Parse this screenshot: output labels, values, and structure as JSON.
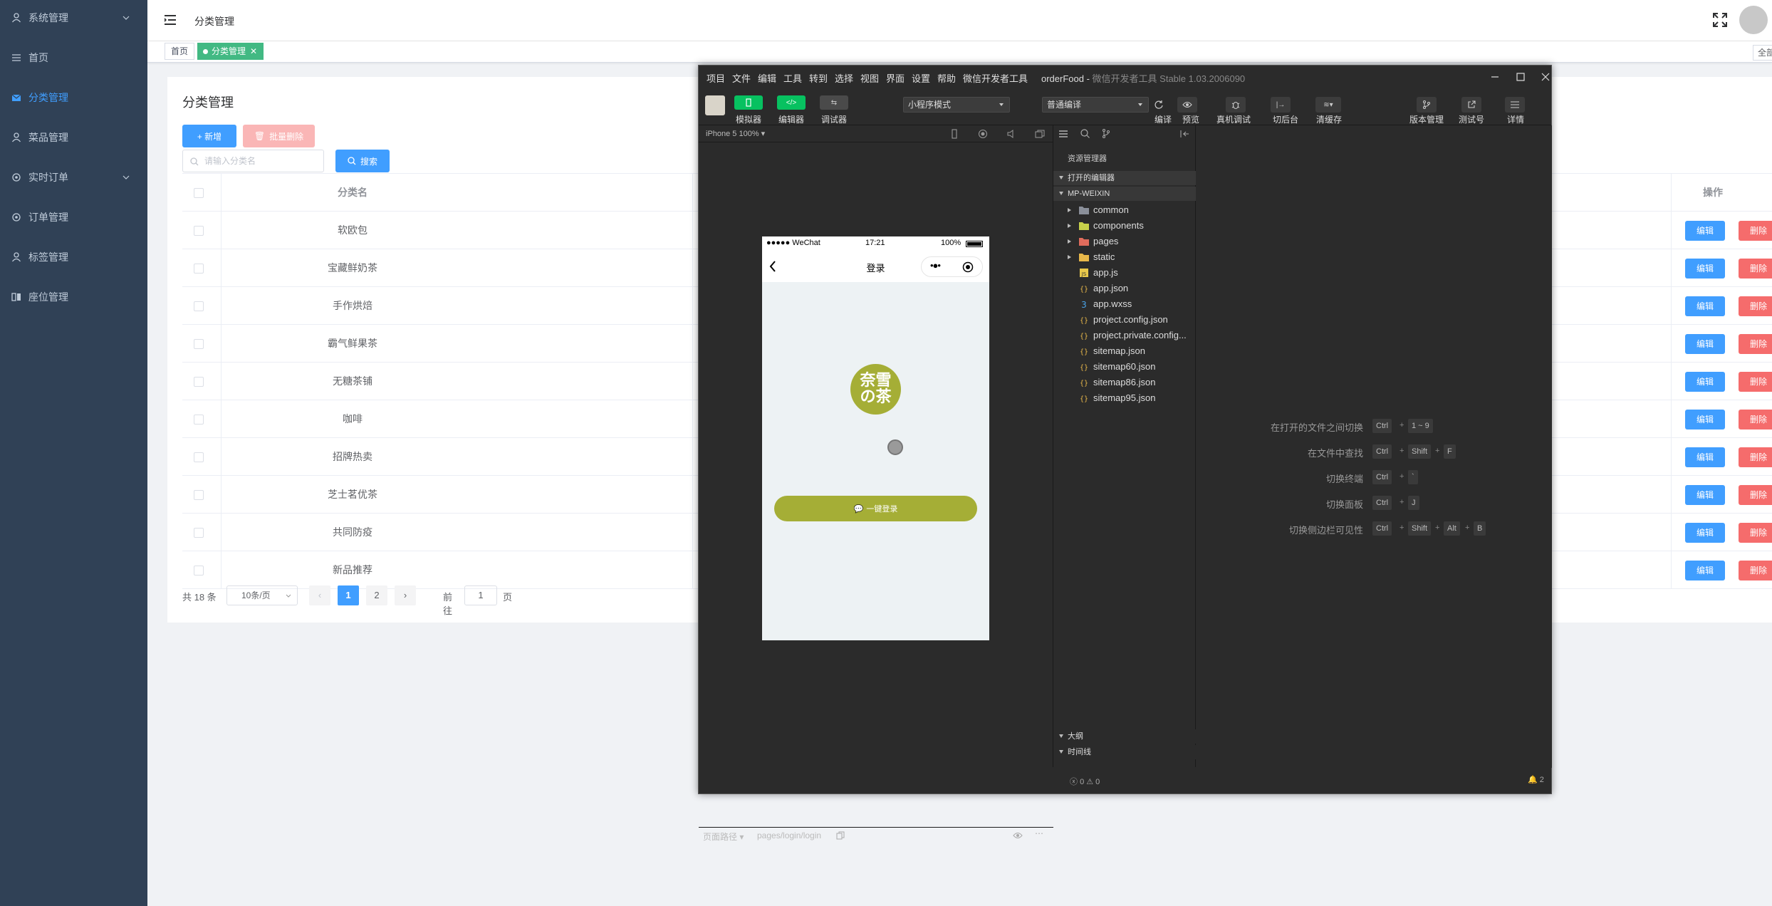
{
  "sidebar": {
    "items": [
      {
        "label": "系统管理",
        "icon": "user-icon",
        "expandable": true
      },
      {
        "label": "首页",
        "icon": "list-icon"
      },
      {
        "label": "分类管理",
        "icon": "mail-icon",
        "active": true
      },
      {
        "label": "菜品管理",
        "icon": "user-icon"
      },
      {
        "label": "实时订单",
        "icon": "gear-icon",
        "expandable": true
      },
      {
        "label": "订单管理",
        "icon": "gear-icon"
      },
      {
        "label": "标签管理",
        "icon": "user-icon"
      },
      {
        "label": "座位管理",
        "icon": "grid-icon"
      }
    ]
  },
  "header": {
    "breadcrumb": "分类管理"
  },
  "tags": {
    "home": "首页",
    "active": "分类管理",
    "close_all": "全部"
  },
  "page": {
    "title": "分类管理",
    "add_label": "+ 新增",
    "batch_delete_label": "批量删除",
    "search_placeholder": "请输入分类名",
    "search_label": "搜索",
    "column_name": "分类名",
    "column_action": "操作",
    "edit_label": "编辑",
    "delete_label": "删除",
    "rows": [
      "软欧包",
      "宝藏鲜奶茶",
      "手作烘焙",
      "霸气鲜果茶",
      "无糖茶铺",
      "咖啡",
      "招牌热卖",
      "芝士茗优茶",
      "共同防疫",
      "新品推荐"
    ]
  },
  "pager": {
    "total": "共 18 条",
    "page_size": "10条/页",
    "pages": [
      "1",
      "2"
    ],
    "current": "1",
    "goto_label": "前往",
    "goto_value": "1",
    "goto_unit": "页"
  },
  "devtools": {
    "menu": [
      "项目",
      "文件",
      "编辑",
      "工具",
      "转到",
      "选择",
      "视图",
      "界面",
      "设置",
      "帮助",
      "微信开发者工具"
    ],
    "project": "orderFood",
    "app_title": "微信开发者工具 Stable 1.03.2006090",
    "toolbar": {
      "simulator": "模拟器",
      "editor": "编辑器",
      "debugger": "调试器",
      "mode": "小程序模式",
      "compile_mode": "普通编译",
      "compile": "编译",
      "preview": "预览",
      "remote_debug": "真机调试",
      "background": "切后台",
      "clear_cache": "清缓存",
      "version": "版本管理",
      "test": "测试号",
      "detail": "详情"
    },
    "simulator": {
      "device": "iPhone 5 100%",
      "path_label": "页面路径",
      "path": "pages/login/login"
    },
    "phone": {
      "carrier": "●●●●● WeChat",
      "time": "17:21",
      "battery": "100%",
      "title": "登录",
      "logo_line1": "奈雪",
      "logo_line2": "の茶",
      "login_button": "一键登录"
    },
    "explorer": {
      "title": "资源管理器",
      "open_editors": "打开的编辑器",
      "root": "MP-WEIXIN",
      "files": [
        {
          "name": "common",
          "type": "folder",
          "color": "#8a8f99"
        },
        {
          "name": "components",
          "type": "folder",
          "color": "#c7d14a"
        },
        {
          "name": "pages",
          "type": "folder",
          "color": "#e06c5c"
        },
        {
          "name": "static",
          "type": "folder",
          "color": "#e8b84a"
        },
        {
          "name": "app.js",
          "type": "js",
          "color": "#e8c84a"
        },
        {
          "name": "app.json",
          "type": "json",
          "color": "#e8b84a"
        },
        {
          "name": "app.wxss",
          "type": "wxss",
          "color": "#4aa3e8"
        },
        {
          "name": "project.config.json",
          "type": "json",
          "color": "#e8b84a"
        },
        {
          "name": "project.private.config...",
          "type": "json",
          "color": "#e8b84a"
        },
        {
          "name": "sitemap.json",
          "type": "json",
          "color": "#e8b84a"
        },
        {
          "name": "sitemap60.json",
          "type": "json",
          "color": "#e8b84a"
        },
        {
          "name": "sitemap86.json",
          "type": "json",
          "color": "#e8b84a"
        },
        {
          "name": "sitemap95.json",
          "type": "json",
          "color": "#e8b84a"
        }
      ],
      "outline": "大纲",
      "timeline": "时间线"
    },
    "shortcuts": [
      {
        "label": "在打开的文件之间切换",
        "keys": [
          "Ctrl",
          "1 ~ 9"
        ]
      },
      {
        "label": "在文件中查找",
        "keys": [
          "Ctrl",
          "Shift",
          "F"
        ]
      },
      {
        "label": "切换终端",
        "keys": [
          "Ctrl",
          "`"
        ]
      },
      {
        "label": "切换面板",
        "keys": [
          "Ctrl",
          "J"
        ]
      },
      {
        "label": "切换侧边栏可见性",
        "keys": [
          "Ctrl",
          "Shift",
          "Alt",
          "B"
        ]
      }
    ],
    "status": {
      "errors": "0",
      "warnings": "0",
      "notifications": "2"
    }
  },
  "colors": {
    "sidebar": "#304156",
    "primary": "#409eff",
    "danger": "#f56c6c",
    "tag": "#42b983",
    "brand": "#a5ae36"
  }
}
